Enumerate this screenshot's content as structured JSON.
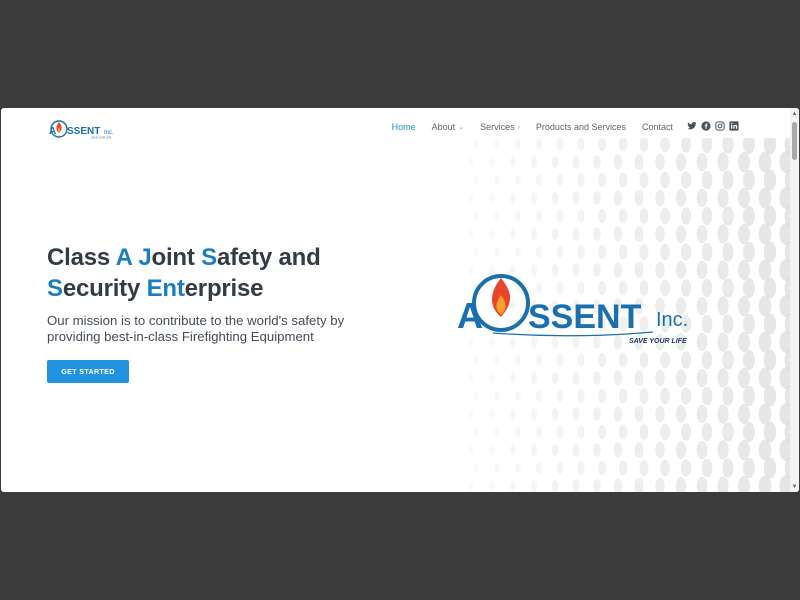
{
  "brand": {
    "logo_name": "AUSSENT",
    "logo_suffix": "Inc.",
    "tagline": "SAVE YOUR LIFE"
  },
  "nav": {
    "items": [
      {
        "label": "Home",
        "active": true,
        "icon": ""
      },
      {
        "label": "About",
        "active": false,
        "icon": "chevron-down-icon"
      },
      {
        "label": "Services",
        "active": false,
        "icon": "chevron-right-icon"
      },
      {
        "label": "Products and Services",
        "active": false,
        "icon": ""
      },
      {
        "label": "Contact",
        "active": false,
        "icon": ""
      }
    ],
    "social": [
      "twitter-icon",
      "facebook-icon",
      "instagram-icon",
      "linkedin-icon"
    ]
  },
  "hero": {
    "title_parts": [
      {
        "text": "Class ",
        "hl": false
      },
      {
        "text": "A",
        "hl": true
      },
      {
        "text": " ",
        "hl": false
      },
      {
        "text": "J",
        "hl": true
      },
      {
        "text": "oint ",
        "hl": false
      },
      {
        "text": "S",
        "hl": true
      },
      {
        "text": "afety and",
        "hl": false
      },
      {
        "text": "\n",
        "hl": false
      },
      {
        "text": "S",
        "hl": true
      },
      {
        "text": "ecurity ",
        "hl": false
      },
      {
        "text": "Ent",
        "hl": true
      },
      {
        "text": "erprise",
        "hl": false
      }
    ],
    "subtitle": "Our mission is to contribute to the world's safety by providing best-in-class Firefighting Equipment",
    "cta_label": "GET STARTED"
  },
  "colors": {
    "accent": "#1a7fc0",
    "button": "#1f93dd",
    "title": "#333b47",
    "nav_active": "#2a8fc9"
  }
}
